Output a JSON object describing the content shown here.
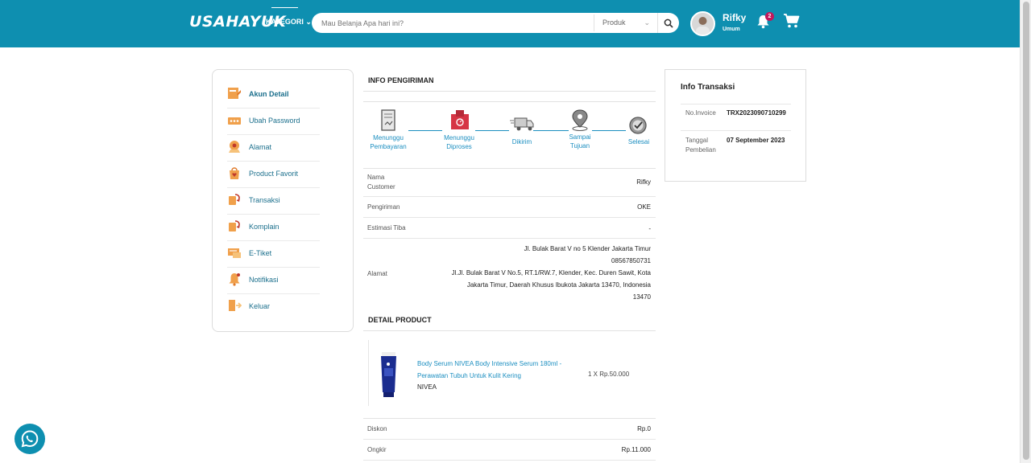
{
  "header": {
    "logo": "USAHAYUK",
    "kategori": "KATEGORI",
    "search_placeholder": "Mau Belanja Apa hari ini?",
    "search_scope": "Produk",
    "user_name": "Rifky",
    "user_role": "Umum",
    "notif_count": "2"
  },
  "sidebar": {
    "items": [
      {
        "label": "Akun Detail",
        "icon": "user-detail-icon"
      },
      {
        "label": "Ubah Password",
        "icon": "password-icon"
      },
      {
        "label": "Alamat",
        "icon": "location-icon"
      },
      {
        "label": "Product Favorit",
        "icon": "favorite-icon"
      },
      {
        "label": "Transaksi",
        "icon": "transaction-icon"
      },
      {
        "label": "Komplain",
        "icon": "complaint-icon"
      },
      {
        "label": "E-Tiket",
        "icon": "ticket-icon"
      },
      {
        "label": "Notifikasi",
        "icon": "bell-icon"
      },
      {
        "label": "Keluar",
        "icon": "logout-icon"
      }
    ]
  },
  "shipping": {
    "title": "INFO PENGIRIMAN",
    "steps": [
      {
        "line1": "Menunggu",
        "line2": "Pembayaran"
      },
      {
        "line1": "Menunggu",
        "line2": "Diproses"
      },
      {
        "line1": "Dikirim",
        "line2": ""
      },
      {
        "line1": "Sampai",
        "line2": "Tujuan"
      },
      {
        "line1": "Selesai",
        "line2": ""
      }
    ],
    "customer_label1": "Nama",
    "customer_label2": "Customer",
    "customer_value": "Rifky",
    "pengiriman_label": "Pengiriman",
    "pengiriman_value": "OKE",
    "estimasi_label": "Estimasi Tiba",
    "estimasi_value": "-",
    "alamat_label": "Alamat",
    "alamat_line1": "Jl. Bulak Barat V no 5 Klender Jakarta Timur",
    "alamat_line2": "08567850731",
    "alamat_line3": "Jl.Jl. Bulak Barat V No.5, RT.1/RW.7, Klender, Kec. Duren Sawit, Kota",
    "alamat_line4": "Jakarta Timur, Daerah Khusus Ibukota Jakarta 13470, Indonesia",
    "alamat_line5": "13470"
  },
  "product": {
    "title": "DETAIL PRODUCT",
    "name_line1": "Body Serum NIVEA Body Intensive Serum 180ml -",
    "name_line2": "Perawatan Tubuh Untuk Kulit Kering",
    "brand": "NIVEA",
    "qty_price": "1 X Rp.50.000",
    "diskon_label": "Diskon",
    "diskon_value": "Rp.0",
    "ongkir_label": "Ongkir",
    "ongkir_value": "Rp.11.000"
  },
  "transaksi": {
    "title": "Info Transaksi",
    "invoice_label": "No.Invoice",
    "invoice_value": "TRX2023090710299",
    "tanggal_label1": "Tanggal",
    "tanggal_label2": "Pembelian",
    "tanggal_value": "07 September 2023"
  },
  "colors": {
    "brand": "#0e8fb0",
    "link": "#1b8ec0",
    "sidebar_icon": "#f0a04b"
  }
}
